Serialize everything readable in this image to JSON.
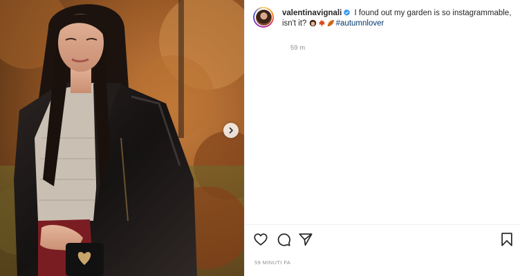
{
  "post": {
    "username": "valentinavignali",
    "caption_text": " I found out my garden is so instagrammable, isn't it? ",
    "hashtag": "#autumnlover",
    "caption_time": "59 m",
    "post_time": "59 MINUTI FA",
    "verified": true,
    "caption_emojis": [
      "woman-emoji",
      "maple-leaf-emoji",
      "fallen-leaf-emoji"
    ]
  },
  "icons": {
    "next": "chevron-right-icon",
    "like": "heart-icon",
    "comment": "comment-icon",
    "share": "paper-plane-icon",
    "save": "bookmark-icon",
    "verified": "verified-badge-icon"
  },
  "colors": {
    "verified_blue": "#3897f0",
    "hashtag": "#00376b",
    "muted": "#8e8e8e",
    "text": "#262626"
  }
}
